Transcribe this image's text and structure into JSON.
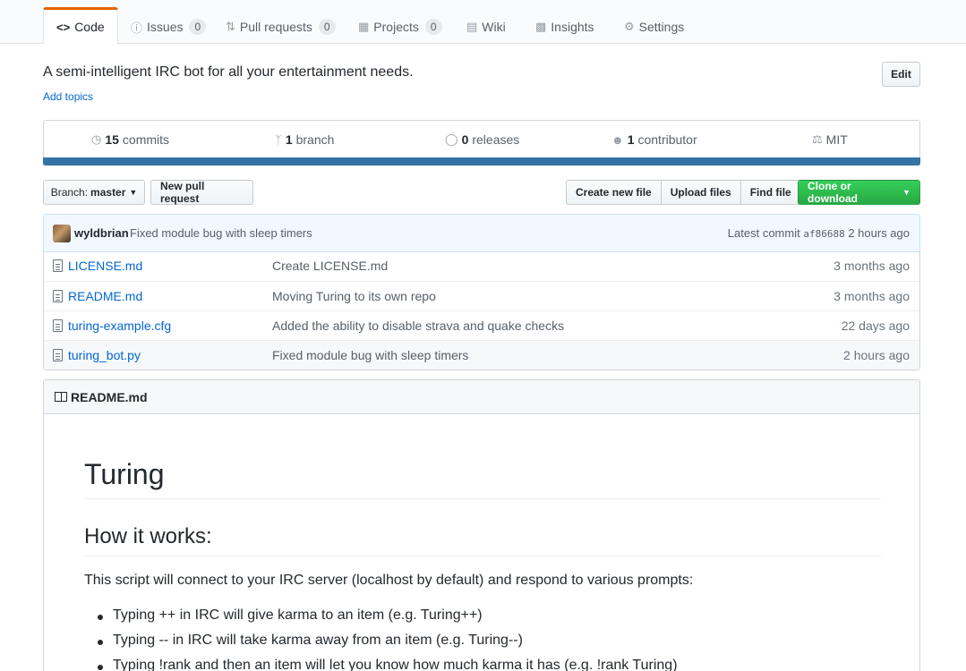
{
  "tabs": [
    {
      "label": "Code",
      "icon": "code-icon"
    },
    {
      "label": "Issues",
      "count": "0",
      "icon": "issue-icon"
    },
    {
      "label": "Pull requests",
      "count": "0",
      "icon": "pull-request-icon"
    },
    {
      "label": "Projects",
      "count": "0",
      "icon": "project-icon"
    },
    {
      "label": "Wiki",
      "icon": "book-icon"
    },
    {
      "label": "Insights",
      "icon": "graph-icon"
    },
    {
      "label": "Settings",
      "icon": "gear-icon"
    }
  ],
  "repo": {
    "description": "A semi-intelligent IRC bot for all your entertainment needs.",
    "add_topics": "Add topics",
    "edit_label": "Edit"
  },
  "summary": {
    "commits_count": "15",
    "commits_label": "commits",
    "branch_count": "1",
    "branch_label": "branch",
    "releases_count": "0",
    "releases_label": "releases",
    "contributors_count": "1",
    "contributors_label": "contributor",
    "license": "MIT",
    "language_color": "#3572a5"
  },
  "toolbar": {
    "branch_prefix": "Branch:",
    "branch_name": "master",
    "new_pr": "New pull request",
    "create_file": "Create new file",
    "upload_files": "Upload files",
    "find_file": "Find file",
    "clone": "Clone or download"
  },
  "latest_commit": {
    "author": "wyldbrian",
    "message": "Fixed module bug with sleep timers",
    "prefix": "Latest commit",
    "sha": "af86688",
    "age": "2 hours ago"
  },
  "files": [
    {
      "name": "LICENSE.md",
      "message": "Create LICENSE.md",
      "age": "3 months ago"
    },
    {
      "name": "README.md",
      "message": "Moving Turing to its own repo",
      "age": "3 months ago"
    },
    {
      "name": "turing-example.cfg",
      "message": "Added the ability to disable strava and quake checks",
      "age": "22 days ago"
    },
    {
      "name": "turing_bot.py",
      "message": "Fixed module bug with sleep timers",
      "age": "2 hours ago"
    }
  ],
  "readme": {
    "filename": "README.md",
    "h1": "Turing",
    "h2": "How it works:",
    "intro": "This script will connect to your IRC server (localhost by default) and respond to various prompts:",
    "items": [
      "Typing ++ in IRC will give karma to an item (e.g. Turing++)",
      "Typing -- in IRC will take karma away from an item (e.g. Turing--)",
      "Typing !rank and then an item will let you know how much karma it has (e.g. !rank Turing)"
    ]
  }
}
